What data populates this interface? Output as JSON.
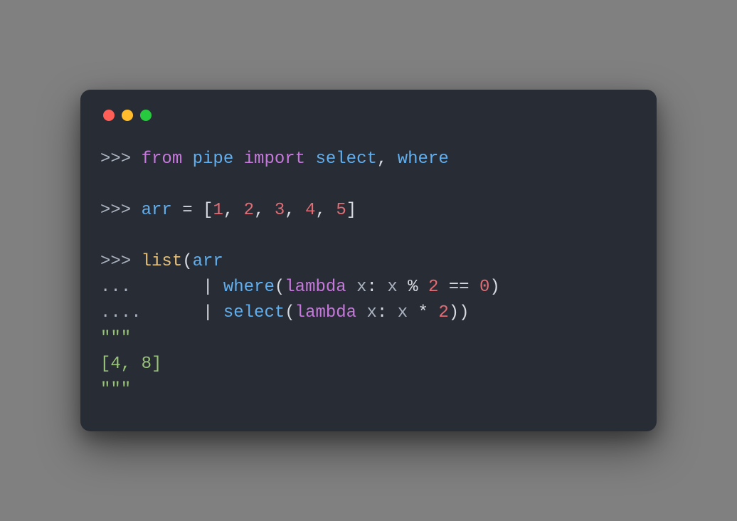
{
  "window": {
    "buttons": [
      "close",
      "minimize",
      "zoom"
    ]
  },
  "code": {
    "line1": {
      "prompt": ">>> ",
      "from": "from",
      "sp1": " ",
      "module": "pipe",
      "sp2": " ",
      "import": "import",
      "sp3": " ",
      "name1": "select",
      "comma": ", ",
      "name2": "where"
    },
    "blank1": "",
    "line2": {
      "prompt": ">>> ",
      "var": "arr",
      "sp1": " ",
      "eq": "=",
      "sp2": " ",
      "lb": "[",
      "n1": "1",
      "c1": ", ",
      "n2": "2",
      "c2": ", ",
      "n3": "3",
      "c3": ", ",
      "n4": "4",
      "c4": ", ",
      "n5": "5",
      "rb": "]"
    },
    "blank2": "",
    "line3": {
      "prompt": ">>> ",
      "list": "list",
      "lp": "(",
      "arr": "arr"
    },
    "line4": {
      "prompt": "...       ",
      "pipe": "|",
      "sp": " ",
      "where": "where",
      "lp": "(",
      "lambda": "lambda",
      "sp2": " ",
      "x": "x",
      "colon": ": ",
      "x2": "x",
      "sp3": " ",
      "mod": "%",
      "sp4": " ",
      "two": "2",
      "sp5": " ",
      "eqeq": "==",
      "sp6": " ",
      "zero": "0",
      "rp": ")"
    },
    "line5": {
      "prompt": "....      ",
      "pipe": "|",
      "sp": " ",
      "select": "select",
      "lp": "(",
      "lambda": "lambda",
      "sp2": " ",
      "x": "x",
      "colon": ": ",
      "x2": "x",
      "sp3": " ",
      "star": "*",
      "sp4": " ",
      "two": "2",
      "rp": "))"
    },
    "line6": "\"\"\"",
    "line7": "[4, 8]",
    "line8": "\"\"\""
  }
}
